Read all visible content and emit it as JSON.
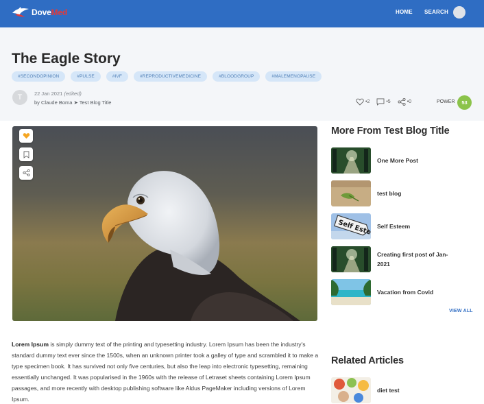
{
  "nav": {
    "brand_dove": "Dove",
    "brand_med": "Med",
    "home": "HOME",
    "search": "SEARCH"
  },
  "article": {
    "title": "The Eagle Story",
    "tags": [
      "#SECONDOPINION",
      "#PULSE",
      "#IVF",
      "#REPRODUCTIVEMEDICINE",
      "#BLOODGROUP",
      "#MALEMENOPAUSE"
    ],
    "author_initial": "T",
    "date": "22 Jan 2021",
    "edited": "(edited)",
    "byline": "by Claude Boma ➤ Test Blog Title",
    "likes": "•2",
    "comments": "•5",
    "shares": "•0",
    "power_label": "POWER",
    "power_value": "53",
    "body_lead": "Lorem Ipsum",
    "body_rest": " is simply dummy text of the printing and typesetting industry. Lorem Ipsum has been the industry's standard dummy text ever since the 1500s, when an unknown printer took a galley of type and scrambled it to make a type specimen book. It has survived not only five centuries, but also the leap into electronic typesetting, remaining essentially unchanged. It was popularised in the 1960s with the release of Letraset sheets containing Lorem Ipsum passages, and more recently with desktop publishing software like Aldus PageMaker including versions of Lorem Ipsum."
  },
  "sidebar": {
    "more_heading": "More From Test Blog Title",
    "more_items": [
      {
        "title": "One More Post"
      },
      {
        "title": "test blog"
      },
      {
        "title": "Self Esteem",
        "thumb_text": "Self Esteem"
      },
      {
        "title": "Creating first post of Jan-2021"
      },
      {
        "title": "Vacation from Covid"
      }
    ],
    "view_all": "VIEW ALL",
    "related_heading": "Related Articles",
    "related_items": [
      {
        "title": "diet test"
      }
    ]
  },
  "colors": {
    "nav_bg": "#2f6dc3",
    "tag_bg": "#d5e6f8",
    "power_badge": "#8bc34a",
    "like_active": "#f5a623"
  }
}
